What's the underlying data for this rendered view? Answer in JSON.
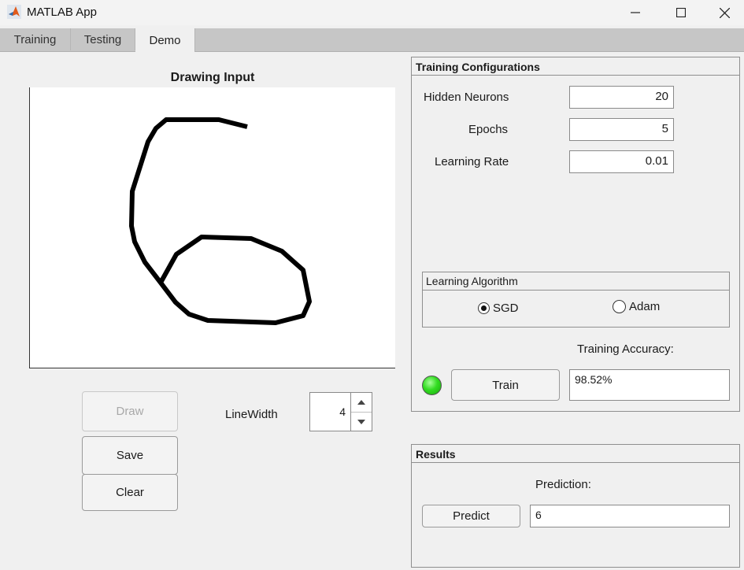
{
  "window": {
    "title": "MATLAB App"
  },
  "tabs": [
    {
      "label": "Training"
    },
    {
      "label": "Testing"
    },
    {
      "label": "Demo"
    }
  ],
  "drawing": {
    "title": "Drawing Input"
  },
  "controls": {
    "draw_label": "Draw",
    "save_label": "Save",
    "clear_label": "Clear",
    "linewidth_label": "LineWidth",
    "linewidth_value": "4"
  },
  "training_config": {
    "title": "Training Configurations",
    "hidden_neurons_label": "Hidden Neurons",
    "hidden_neurons_value": "20",
    "epochs_label": "Epochs",
    "epochs_value": "5",
    "learning_rate_label": "Learning Rate",
    "learning_rate_value": "0.01",
    "algorithm": {
      "title": "Learning Algorithm",
      "options": [
        {
          "label": "SGD",
          "selected": true
        },
        {
          "label": "Adam",
          "selected": false
        }
      ]
    },
    "accuracy_label": "Training Accuracy:",
    "accuracy_value": "98.52%",
    "train_label": "Train",
    "status_color": "#22cc22"
  },
  "results": {
    "title": "Results",
    "prediction_label": "Prediction:",
    "predict_label": "Predict",
    "prediction_value": "6"
  }
}
